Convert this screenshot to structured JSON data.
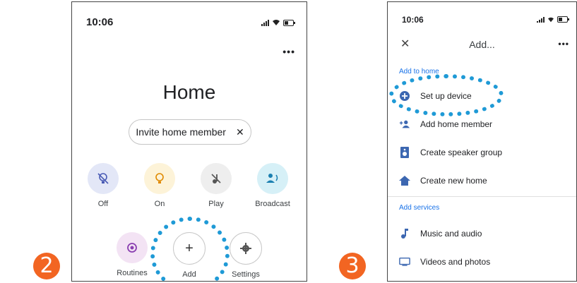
{
  "badges": {
    "step2": "2",
    "step3": "3"
  },
  "phone1": {
    "time": "10:06",
    "title": "Home",
    "invite_label": "Invite home member",
    "invite_close": "✕",
    "actions": [
      {
        "label": "Off",
        "icon": "lightbulb-off-icon"
      },
      {
        "label": "On",
        "icon": "lightbulb-icon"
      },
      {
        "label": "Play",
        "icon": "music-off-icon"
      },
      {
        "label": "Broadcast",
        "icon": "broadcast-icon"
      },
      {
        "label": "Routines",
        "icon": "routines-icon"
      },
      {
        "label": "Add",
        "icon": "plus-icon"
      },
      {
        "label": "Settings",
        "icon": "gear-icon"
      }
    ]
  },
  "phone2": {
    "time": "10:06",
    "close": "✕",
    "title": "Add...",
    "section_home": "Add to home",
    "home_items": [
      {
        "label": "Set up device",
        "icon": "add-circle-icon"
      },
      {
        "label": "Add home member",
        "icon": "person-add-icon"
      },
      {
        "label": "Create speaker group",
        "icon": "speaker-icon"
      },
      {
        "label": "Create new home",
        "icon": "home-icon"
      }
    ],
    "section_services": "Add services",
    "service_items": [
      {
        "label": "Music and audio",
        "icon": "music-note-icon"
      },
      {
        "label": "Videos and photos",
        "icon": "tv-icon"
      }
    ]
  },
  "colors": {
    "badge": "#f26522",
    "highlight_ring": "#1f9ad6",
    "accent_blue": "#1a73e8"
  }
}
